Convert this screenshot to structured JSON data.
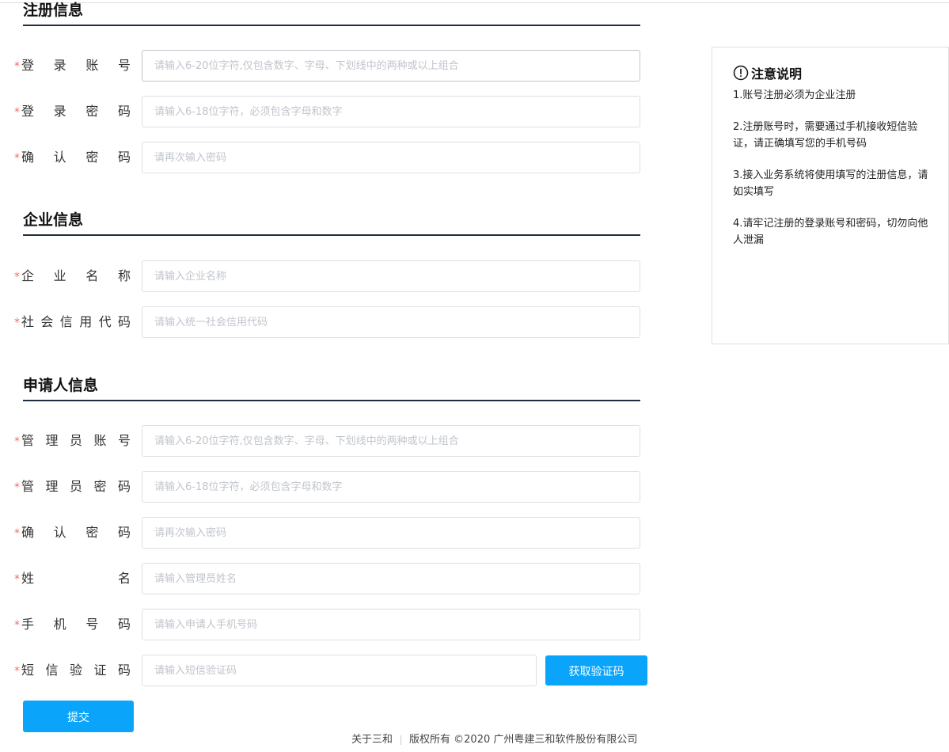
{
  "sections": {
    "registration": {
      "title": "注册信息"
    },
    "company": {
      "title": "企业信息"
    },
    "applicant": {
      "title": "申请人信息"
    }
  },
  "fields": {
    "login_account": {
      "label": "登录账号",
      "placeholder": "请输入6-20位字符,仅包含数字、字母、下划线中的两种或以上组合"
    },
    "login_password": {
      "label": "登录密码",
      "placeholder": "请输入6-18位字符，必须包含字母和数字"
    },
    "confirm_password": {
      "label": "确认密码",
      "placeholder": "请再次输入密码"
    },
    "company_name": {
      "label": "企业名称",
      "placeholder": "请输入企业名称"
    },
    "credit_code": {
      "label": "社会信用代码",
      "placeholder": "请输入统一社会信用代码"
    },
    "admin_account": {
      "label": "管理员账号",
      "placeholder": "请输入6-20位字符,仅包含数字、字母、下划线中的两种或以上组合"
    },
    "admin_password": {
      "label": "管理员密码",
      "placeholder": "请输入6-18位字符，必须包含字母和数字"
    },
    "admin_confirm_password": {
      "label": "确认密码",
      "placeholder": "请再次输入密码"
    },
    "admin_name": {
      "label": "姓名",
      "placeholder": "请输入管理员姓名"
    },
    "mobile": {
      "label": "手机号码",
      "placeholder": "请输入申请人手机号码"
    },
    "sms_code": {
      "label": "短信验证码",
      "placeholder": "请输入短信验证码"
    }
  },
  "required_mark": "*",
  "buttons": {
    "get_code": "获取验证码",
    "submit": "提交"
  },
  "notice": {
    "icon": "exclamation-circle-icon",
    "title": "注意说明",
    "items": [
      "1.账号注册必须为企业注册",
      "2.注册账号时，需要通过手机接收短信验证，请正确填写您的手机号码",
      "3.接入业务系统将使用填写的注册信息，请如实填写",
      "4.请牢记注册的登录账号和密码，切勿向他人泄漏"
    ]
  },
  "footer": {
    "about": "关于三和",
    "copyright": "版权所有 ©2020 广州粤建三和软件股份有限公司"
  },
  "colors": {
    "primary": "#0aa5fa",
    "required": "#f56c6c",
    "section_rule": "#1f2d3d"
  }
}
